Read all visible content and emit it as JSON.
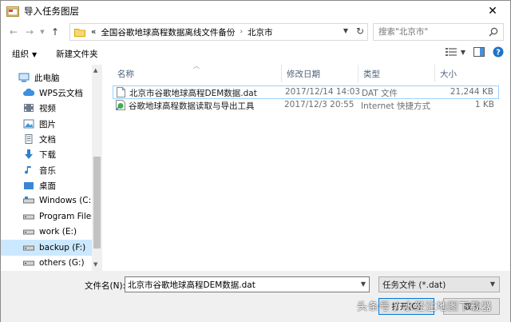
{
  "window": {
    "title": "导入任务图层",
    "close_glyph": "✕"
  },
  "address": {
    "crumbs": [
      "«",
      "全国谷歌地球高程数据离线文件备份",
      "北京市"
    ],
    "search_placeholder": "搜索\"北京市\""
  },
  "toolbar": {
    "organize_label": "组织",
    "new_folder_label": "新建文件夹"
  },
  "sidebar": {
    "items": [
      {
        "label": "此电脑",
        "icon": "computer-icon"
      },
      {
        "label": "WPS云文档",
        "icon": "wps-cloud-icon"
      },
      {
        "label": "视频",
        "icon": "video-folder-icon"
      },
      {
        "label": "图片",
        "icon": "pictures-folder-icon"
      },
      {
        "label": "文档",
        "icon": "documents-folder-icon"
      },
      {
        "label": "下载",
        "icon": "download-icon"
      },
      {
        "label": "音乐",
        "icon": "music-icon"
      },
      {
        "label": "桌面",
        "icon": "desktop-folder-icon"
      },
      {
        "label": "Windows (C:)",
        "icon": "drive-icon"
      },
      {
        "label": "Program Files (",
        "icon": "drive-icon"
      },
      {
        "label": "work (E:)",
        "icon": "drive-icon"
      },
      {
        "label": "backup (F:)",
        "icon": "drive-icon"
      },
      {
        "label": "others (G:)",
        "icon": "drive-icon"
      }
    ]
  },
  "columns": {
    "name": "名称",
    "modified": "修改日期",
    "type": "类型",
    "size": "大小"
  },
  "files": [
    {
      "name": "北京市谷歌地球高程DEM数据.dat",
      "modified": "2017/12/14 14:03",
      "type": "DAT 文件",
      "size": "21,244 KB"
    },
    {
      "name": "谷歌地球高程数据读取与导出工具",
      "modified": "2017/12/3 20:55",
      "type": "Internet 快捷方式",
      "size": "1 KB"
    }
  ],
  "footer": {
    "filename_label": "文件名(N):",
    "filename_value": "北京市谷歌地球高程DEM数据.dat",
    "filetype_value": "任务文件 (*.dat)",
    "open_label": "打开(O)",
    "cancel_label": "取消"
  },
  "watermark": "头条号 / 水经注地图下载器",
  "colors": {
    "selection": "#cce8ff",
    "accent": "#0078d7",
    "header_text": "#4c607a"
  }
}
